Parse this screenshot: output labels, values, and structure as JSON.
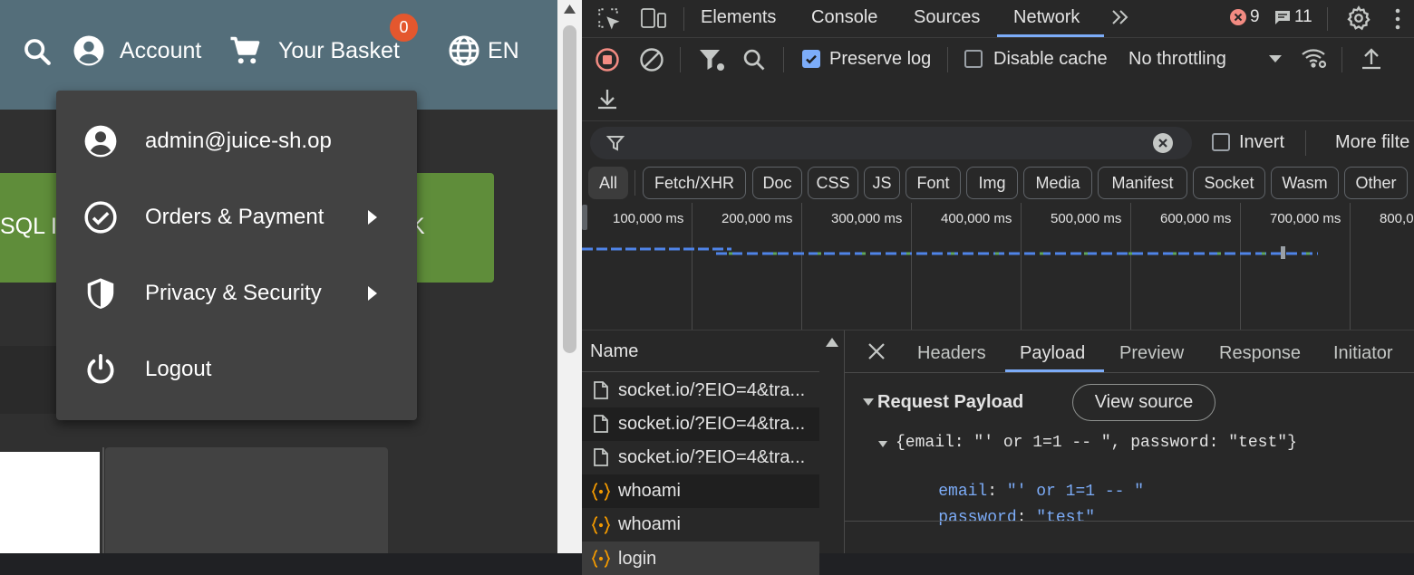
{
  "app": {
    "toolbar": {
      "account_label": "Account",
      "basket_label": "Your Basket",
      "basket_count": "0",
      "language": "EN"
    },
    "banner": {
      "text_left": "SQL I",
      "text_right": "K"
    },
    "account_menu": {
      "items": [
        {
          "label": "admin@juice-sh.op",
          "icon": "account-circle-icon"
        },
        {
          "label": "Orders & Payment",
          "icon": "check-circle-icon",
          "submenu": true
        },
        {
          "label": "Privacy & Security",
          "icon": "shield-icon",
          "submenu": true
        },
        {
          "label": "Logout",
          "icon": "power-icon"
        }
      ]
    }
  },
  "devtools": {
    "tabs": [
      "Elements",
      "Console",
      "Sources",
      "Network"
    ],
    "active_tab": "Network",
    "error_count": "9",
    "message_count": "11",
    "toolbar": {
      "preserve_log_label": "Preserve log",
      "preserve_log_checked": true,
      "disable_cache_label": "Disable cache",
      "disable_cache_checked": false,
      "throttling": "No throttling"
    },
    "filter": {
      "value": "",
      "invert_label": "Invert",
      "more_filters_label": "More filte"
    },
    "type_filters": [
      "All",
      "Fetch/XHR",
      "Doc",
      "CSS",
      "JS",
      "Font",
      "Img",
      "Media",
      "Manifest",
      "Socket",
      "Wasm",
      "Other"
    ],
    "active_type_filter": "All",
    "timeline_labels": [
      "100,000 ms",
      "200,000 ms",
      "300,000 ms",
      "400,000 ms",
      "500,000 ms",
      "600,000 ms",
      "700,000 ms",
      "800,0"
    ],
    "requests": {
      "column_header": "Name",
      "rows": [
        {
          "name": "socket.io/?EIO=4&tra...",
          "type": "document"
        },
        {
          "name": "socket.io/?EIO=4&tra...",
          "type": "document"
        },
        {
          "name": "socket.io/?EIO=4&tra...",
          "type": "document"
        },
        {
          "name": "whoami",
          "type": "fetch"
        },
        {
          "name": "whoami",
          "type": "fetch"
        },
        {
          "name": "login",
          "type": "fetch"
        }
      ]
    },
    "detail_tabs": [
      "Headers",
      "Payload",
      "Preview",
      "Response",
      "Initiator"
    ],
    "active_detail_tab": "Payload",
    "payload": {
      "section_title": "Request Payload",
      "view_source_label": "View source",
      "summary": "{email: \"' or 1=1 -- \", password: \"test\"}",
      "fields": [
        {
          "key": "email",
          "value": "\"' or 1=1 -- \""
        },
        {
          "key": "password",
          "value": "\"test\""
        }
      ]
    }
  },
  "colors": {
    "toolbar": "#546e7a",
    "banner_green": "#5f8d3a",
    "badge": "#e4572e",
    "accent_blue": "#7cacf8",
    "json_key": "#7cacf8",
    "json_string": "#7cacf8"
  }
}
